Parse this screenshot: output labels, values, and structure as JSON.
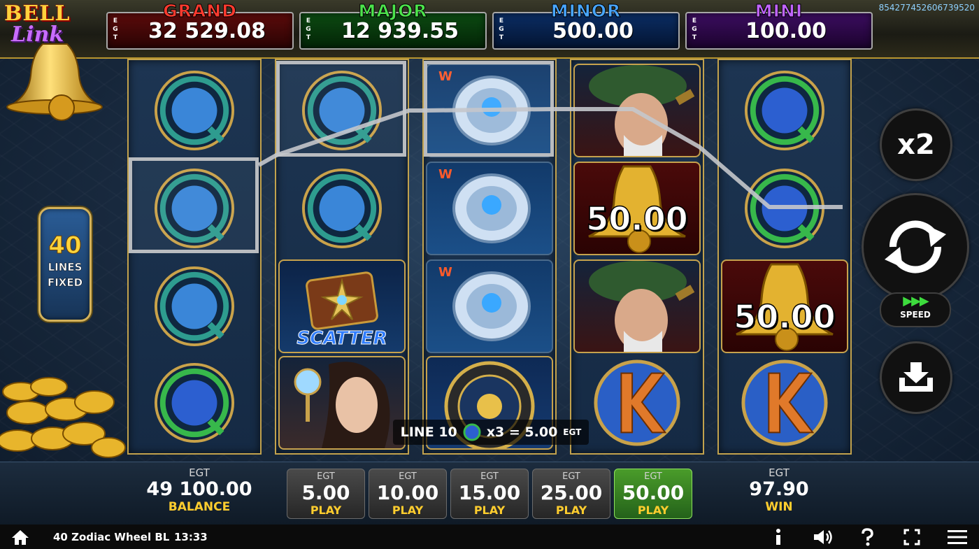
{
  "session_id": "854277452606739520",
  "jackpots": [
    {
      "name": "GRAND",
      "label": "E G T",
      "value": "32 529.08"
    },
    {
      "name": "MAJOR",
      "label": "E G T",
      "value": "12 939.55"
    },
    {
      "name": "MINOR",
      "label": "E G T",
      "value": "500.00"
    },
    {
      "name": "MINI",
      "label": "E G T",
      "value": "100.00"
    }
  ],
  "logo": {
    "top": "BELL",
    "bottom": "Link"
  },
  "lines_badge": {
    "count": "40",
    "line1": "LINES",
    "line2": "FIXED"
  },
  "symbols": {
    "bell_value_1": "50.00",
    "bell_value_2": "50.00",
    "scatter_label": "SCATTER"
  },
  "payline_info": {
    "line": "LINE 10",
    "multiplier": "x3 = 5.00",
    "currency": "EGT"
  },
  "controls": {
    "x2_label": "x2",
    "speed_label": "SPEED",
    "speed_arrows": "▶▶▶"
  },
  "balance": {
    "currency": "EGT",
    "value": "49 100.00",
    "caption": "BALANCE"
  },
  "win": {
    "currency": "EGT",
    "value": "97.90",
    "caption": "WIN"
  },
  "bets": [
    {
      "currency": "EGT",
      "value": "5.00",
      "caption": "PLAY",
      "active": false
    },
    {
      "currency": "EGT",
      "value": "10.00",
      "caption": "PLAY",
      "active": false
    },
    {
      "currency": "EGT",
      "value": "15.00",
      "caption": "PLAY",
      "active": false
    },
    {
      "currency": "EGT",
      "value": "25.00",
      "caption": "PLAY",
      "active": false
    },
    {
      "currency": "EGT",
      "value": "50.00",
      "caption": "PLAY",
      "active": true
    }
  ],
  "system_bar": {
    "game_name": "40 Zodiac Wheel BL",
    "time": "13:33",
    "icons": [
      "home-icon",
      "info-icon",
      "sound-icon",
      "help-icon",
      "fullscreen-icon",
      "menu-icon"
    ]
  },
  "colors": {
    "grand": "#ff3b2f",
    "major": "#4ce34c",
    "minor": "#48a6ff",
    "mini": "#c064ff",
    "accent_gold": "#ffcd2e",
    "active_bet": "#4a9c2a"
  }
}
